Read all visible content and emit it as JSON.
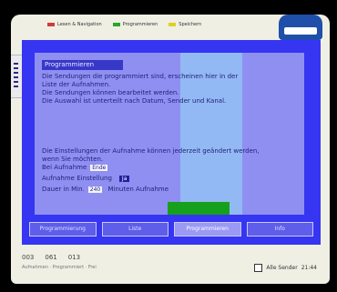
{
  "legend": {
    "items": [
      {
        "label": "Lesen & Navigation",
        "color": "#d23a3a"
      },
      {
        "label": "Programmieren",
        "color": "#2aa52a"
      },
      {
        "label": "Speichern",
        "color": "#e0d020"
      }
    ]
  },
  "panel": {
    "title": "Programmieren",
    "lines": [
      "Die Sendungen die programmiert sind, erscheinen hier in der",
      "Liste der Aufnahmen.",
      "Die Sendungen können bearbeitet werden.",
      "Die Auswahl ist unterteilt nach Datum, Sender und Kanal.",
      "Die Einstellungen der Aufnahme können jederzeit geändert werden,",
      "wenn Sie möchten."
    ],
    "setting_1_label": "Bei Aufnahme",
    "setting_1_value": "Ende",
    "setting_2_label": "Aufnahme Einstellung",
    "setting_2_value": "Ja",
    "setting_3_label": "Dauer in Min.",
    "setting_3_value": "240",
    "setting_3_suffix": "Minuten Aufnahme"
  },
  "tabs": [
    {
      "label": "Programmierung"
    },
    {
      "label": "Liste"
    },
    {
      "label": "Programmieren"
    },
    {
      "label": "Info"
    }
  ],
  "status": {
    "counters": [
      "003",
      "061",
      "013"
    ],
    "sub": "Aufnahmen · Programmiert · Frei",
    "right_label": "Alle Sender",
    "time": "21:44"
  },
  "colors": {
    "accent": "#3535f2",
    "panel": "#8f8ff2",
    "highlight": "#93b9f4",
    "green": "#16a01e"
  }
}
